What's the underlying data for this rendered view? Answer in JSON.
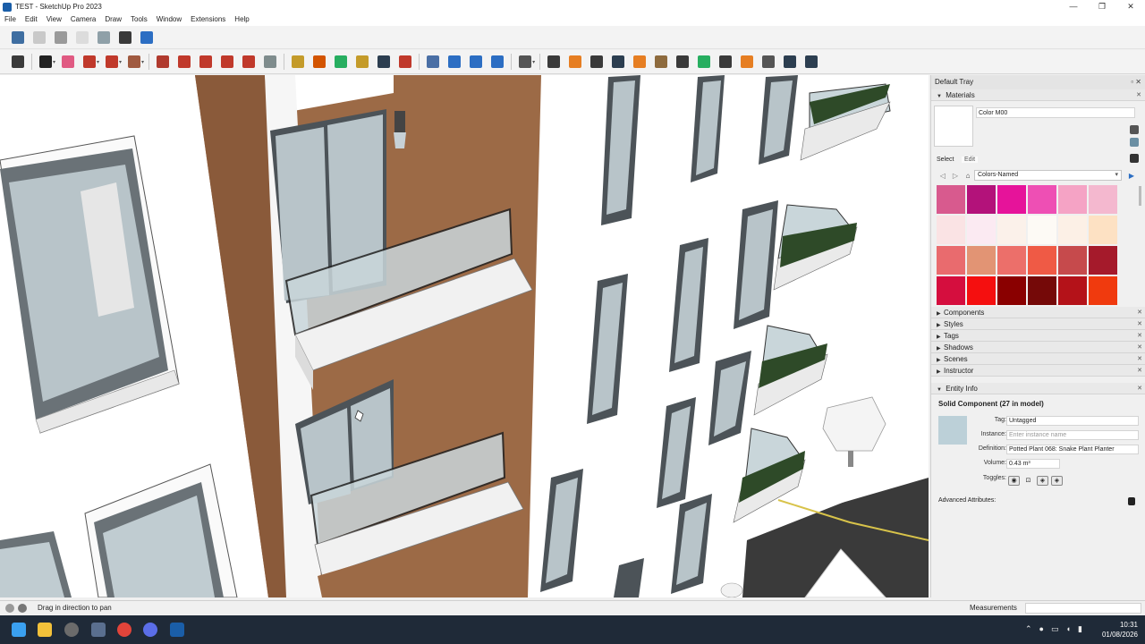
{
  "window": {
    "title": "TEST - SketchUp Pro 2023",
    "controls": [
      "—",
      "❐",
      "✕"
    ]
  },
  "menu": [
    "File",
    "Edit",
    "View",
    "Camera",
    "Draw",
    "Tools",
    "Window",
    "Extensions",
    "Help"
  ],
  "toolbar1": [
    {
      "icon": "iso-view-icon",
      "color": "#3f6ea1"
    },
    {
      "icon": "top-view-icon",
      "color": "#c9c9c9"
    },
    {
      "icon": "front-view-icon",
      "color": "#9a9a9a"
    },
    {
      "icon": "xray-icon",
      "color": "#dcdcdc"
    },
    {
      "icon": "shaded-icon",
      "color": "#8fa0a8"
    },
    {
      "icon": "shaded-textures-icon",
      "color": "#3a3a3a"
    },
    {
      "icon": "monochrome-icon",
      "color": "#2c6ec3"
    }
  ],
  "toolbar2": [
    {
      "icon": "zoom-icon",
      "color": "#3a3a3a"
    },
    {
      "icon": "select-icon",
      "color": "#222222"
    },
    {
      "icon": "eraser-icon",
      "color": "#e05a82"
    },
    {
      "icon": "pencil-icon",
      "color": "#c0392b"
    },
    {
      "icon": "shape-icon",
      "color": "#c0392b"
    },
    {
      "icon": "paint-bucket-icon",
      "color": "#a05a40"
    },
    {
      "icon": "push-pull-icon",
      "color": "#b03a2e"
    },
    {
      "icon": "follow-me-icon",
      "color": "#c0392b"
    },
    {
      "icon": "move-icon",
      "color": "#c0392b"
    },
    {
      "icon": "rotate-icon",
      "color": "#c0392b"
    },
    {
      "icon": "scale-icon",
      "color": "#c0392b"
    },
    {
      "icon": "offset-icon",
      "color": "#7f8c8d"
    },
    {
      "icon": "tape-measure-icon",
      "color": "#c49b2a"
    },
    {
      "icon": "text-icon",
      "color": "#d35400"
    },
    {
      "icon": "orbit-icon",
      "color": "#27ae60"
    },
    {
      "icon": "pan-icon",
      "color": "#c49b2a"
    },
    {
      "icon": "zoom-window-icon",
      "color": "#2c3e50"
    },
    {
      "icon": "zoom-extents-icon",
      "color": "#c0392b"
    },
    {
      "icon": "section-plane-icon",
      "color": "#4a6fa5"
    },
    {
      "icon": "section-display-icon",
      "color": "#2c6ec3"
    },
    {
      "icon": "section-fill-icon",
      "color": "#2c6ec3"
    },
    {
      "icon": "section-cut-icon",
      "color": "#2c6ec3"
    },
    {
      "icon": "user-icon",
      "color": "#555555"
    },
    {
      "icon": "components-icon",
      "color": "#3a3a3a"
    },
    {
      "icon": "tray-toggle-icon",
      "color": "#e67e22"
    },
    {
      "icon": "model-info-icon",
      "color": "#3a3a3a"
    },
    {
      "icon": "add-location-icon",
      "color": "#2c3e50"
    },
    {
      "icon": "styles-icon",
      "color": "#e67e22"
    },
    {
      "icon": "materials-icon",
      "color": "#8e6b3e"
    },
    {
      "icon": "checker-icon",
      "color": "#3a3a3a"
    },
    {
      "icon": "cloud-icon",
      "color": "#27ae60"
    },
    {
      "icon": "settings-icon",
      "color": "#3a3a3a"
    },
    {
      "icon": "layout-icon",
      "color": "#e67e22"
    },
    {
      "icon": "info-icon",
      "color": "#555555"
    },
    {
      "icon": "cart-icon",
      "color": "#2c3e50"
    },
    {
      "icon": "account-icon",
      "color": "#2c3e50"
    }
  ],
  "tray": {
    "title": "Default Tray",
    "materials": {
      "header": "Materials",
      "name": "Color M00",
      "tab_select": "Select",
      "tab_edit": "Edit",
      "library": "Colors-Named",
      "swatches": [
        "#d85a8e",
        "#b3127a",
        "#e6139a",
        "#ee4fb4",
        "#f5a3c5",
        "#f4b8cf",
        "#fae3e4",
        "#fbeaf2",
        "#fbf1ea",
        "#fdfaf5",
        "#fcf0e6",
        "#fde1c3",
        "#e96b6e",
        "#e29474",
        "#ec6f6a",
        "#ef5a45",
        "#c64a4c",
        "#a51a2b",
        "#d50e3e",
        "#f50f0f",
        "#8a0000",
        "#750908",
        "#b41219",
        "#f03a0e"
      ]
    },
    "panels": [
      "Components",
      "Styles",
      "Tags",
      "Shadows",
      "Scenes",
      "Instructor"
    ],
    "entity_info": {
      "header": "Entity Info",
      "title": "Solid Component (27 in model)",
      "tag_label": "Tag:",
      "tag_value": "Untagged",
      "instance_label": "Instance:",
      "instance_placeholder": "Enter instance name",
      "definition_label": "Definition:",
      "definition_value": "Potted Plant 068: Snake Plant Planter",
      "volume_label": "Volume:",
      "volume_value": "0.43 m³",
      "toggles_label": "Toggles:",
      "advanced_label": "Advanced Attributes:"
    }
  },
  "status": {
    "hint": "Drag in direction to pan",
    "measurements_label": "Measurements",
    "measurements_value": ""
  },
  "taskbar": {
    "time": "10:31",
    "date": "01/08/2026"
  }
}
